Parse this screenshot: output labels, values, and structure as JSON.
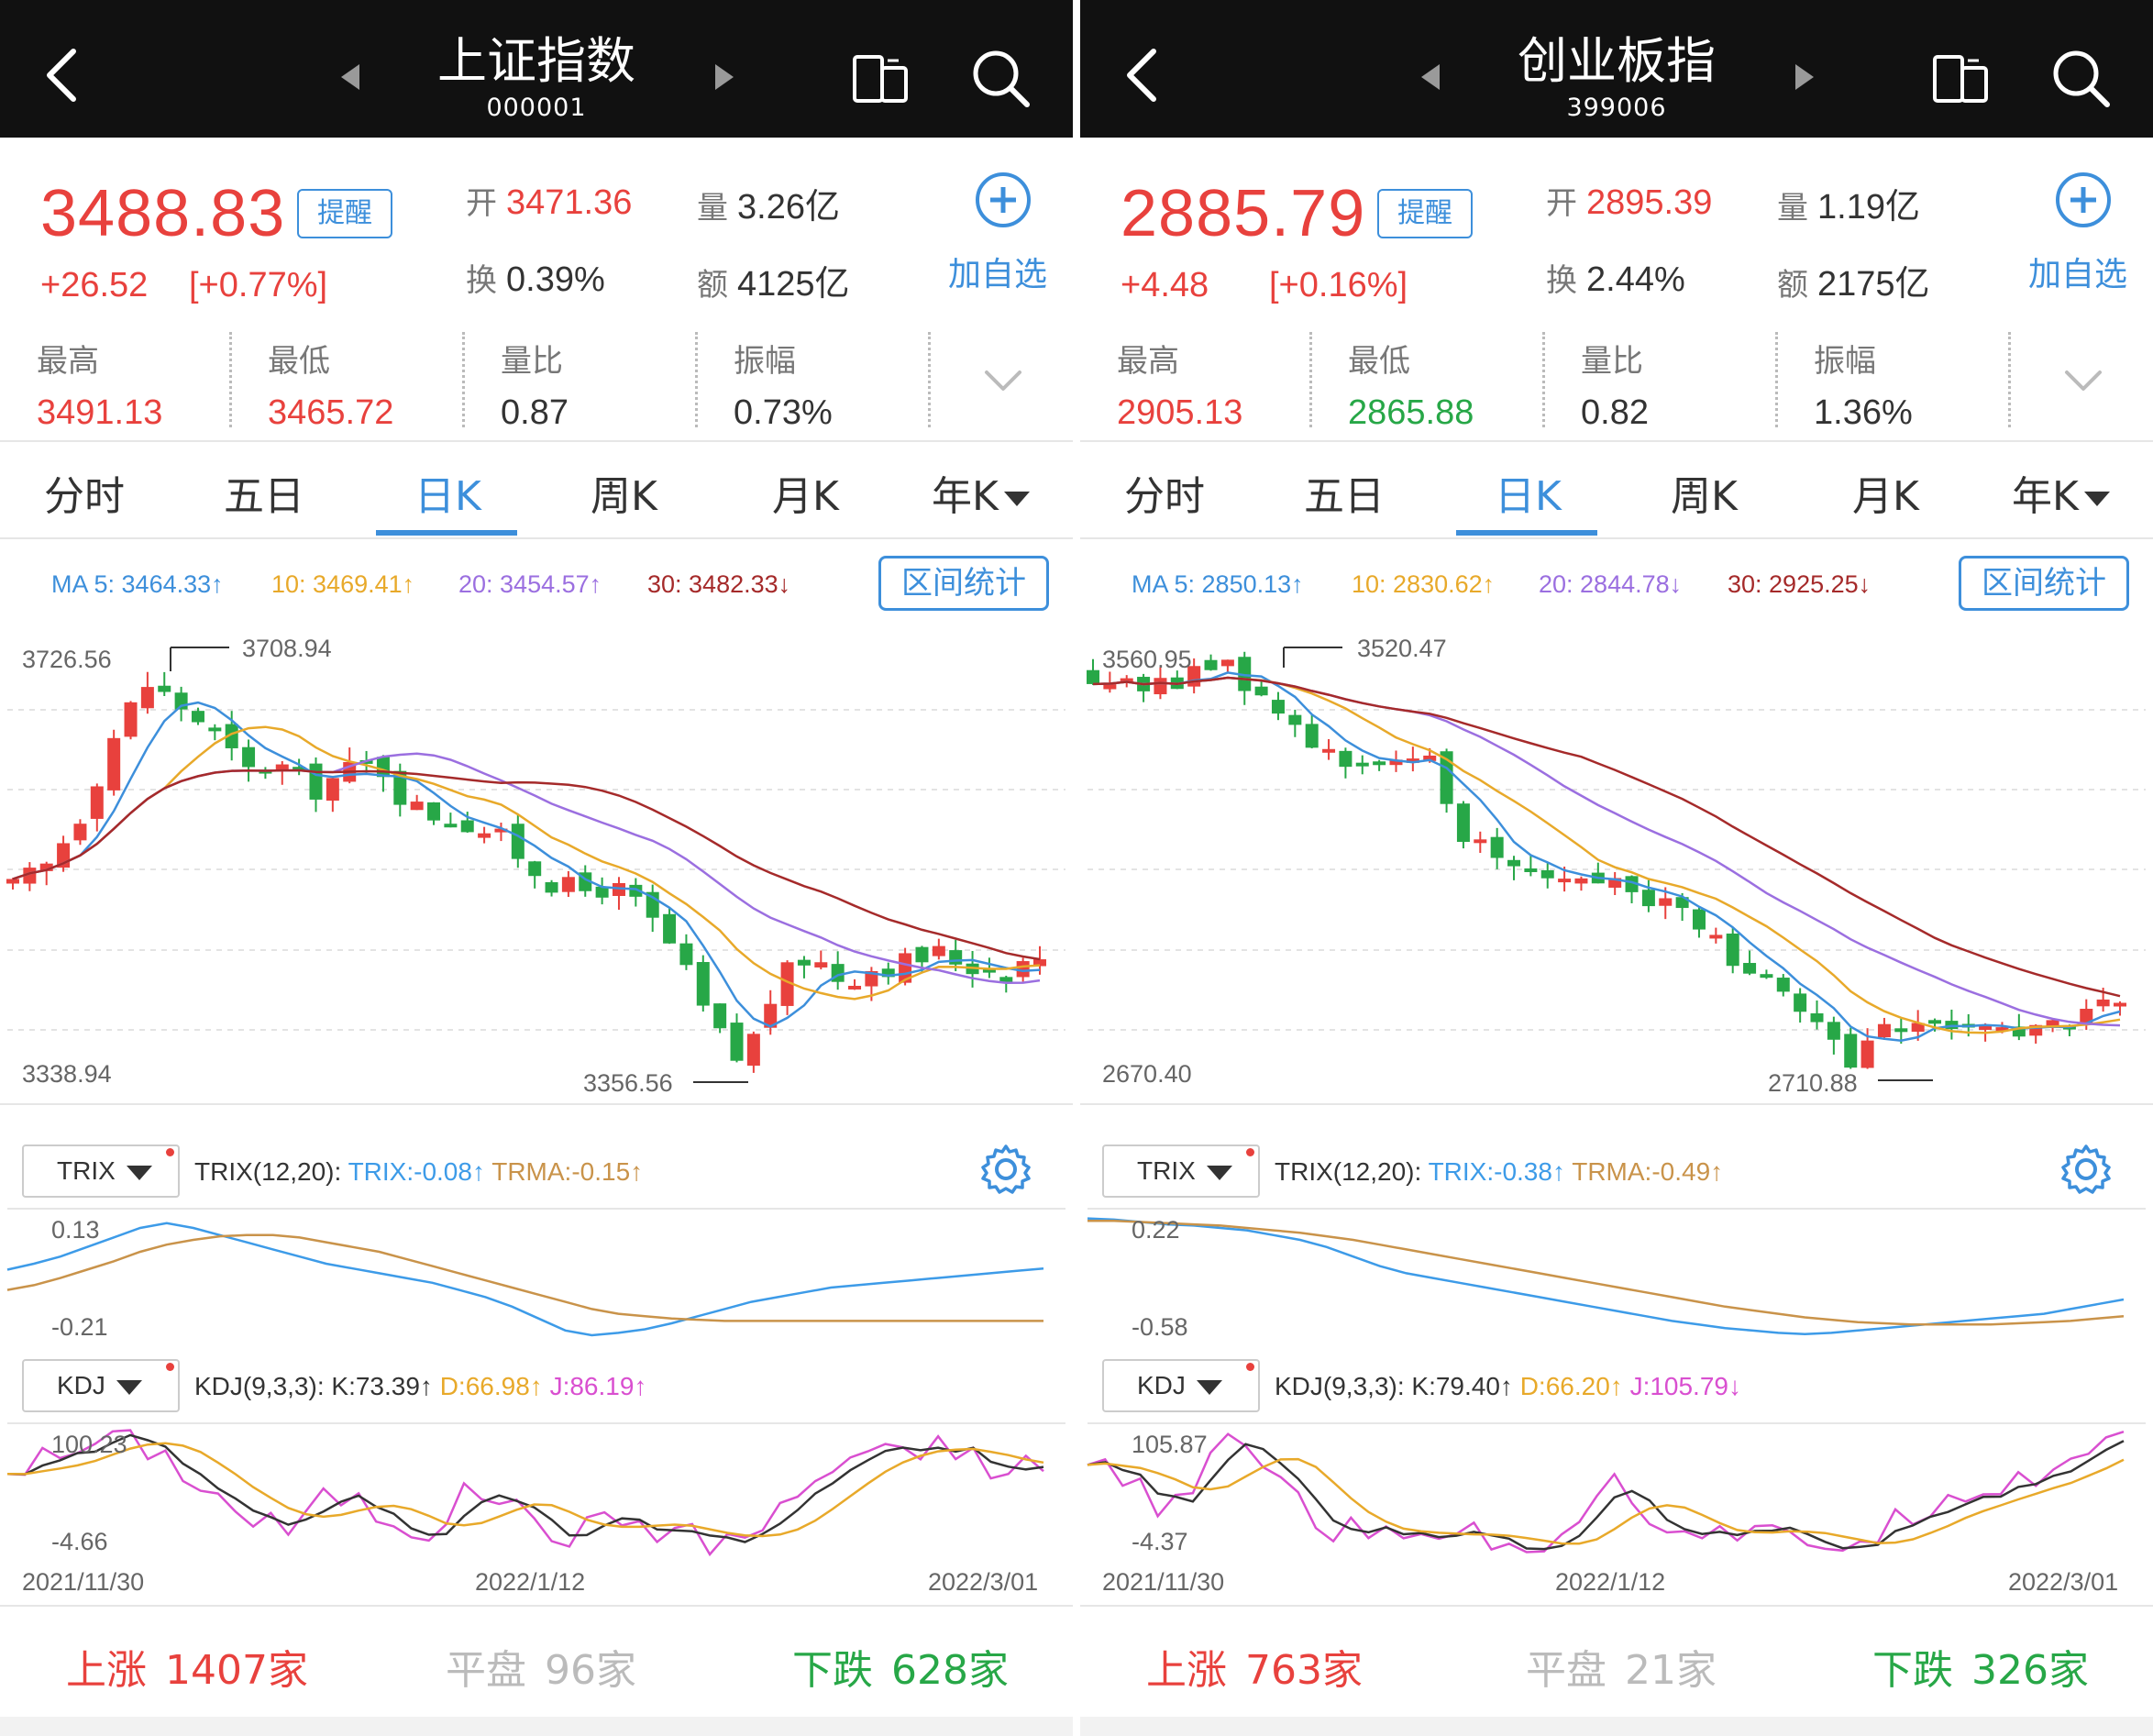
{
  "colors": {
    "up": "#e8413d",
    "down": "#27a747",
    "accent": "#3d8fdb",
    "ma5": "#3d8fdb",
    "ma10": "#e8a92a",
    "ma20": "#9b6fe0",
    "ma30": "#a52a2a",
    "trix": "#3d9be8",
    "trma": "#c9934a",
    "k": "#333333",
    "d": "#e8a92a",
    "j": "#d94fd0"
  },
  "panels": [
    {
      "header": {
        "title": "上证指数",
        "code": "000001"
      },
      "quote": {
        "price": "3488.83",
        "alert_label": "提醒",
        "change": "+26.52",
        "change_pct": "[+0.77%]",
        "open_k": "开",
        "open_v": "3471.36",
        "vol_k": "量",
        "vol_v": "3.26亿",
        "turn_k": "换",
        "turn_v": "0.39%",
        "amt_k": "额",
        "amt_v": "4125亿",
        "add_label": "加自选"
      },
      "stats": [
        {
          "label": "最高",
          "value": "3491.13"
        },
        {
          "label": "最低",
          "value": "3465.72"
        },
        {
          "label": "量比",
          "value": "0.87"
        },
        {
          "label": "振幅",
          "value": "0.73%"
        }
      ],
      "tabs": [
        "分时",
        "五日",
        "日K",
        "周K",
        "月K",
        "年K"
      ],
      "ma": {
        "ma5": "MA 5: 3464.33↑",
        "ma10": "10: 3469.41↑",
        "ma20": "20: 3454.57↑",
        "ma30": "30: 3482.33↓"
      },
      "range_btn": "区间统计",
      "axis": {
        "top": "3726.56",
        "bottom": "3338.94",
        "high_mark": "3708.94",
        "low_mark": "3356.56"
      },
      "trix": {
        "btn": "TRIX",
        "params": "TRIX(12,20):",
        "trix": "TRIX:-0.08↑",
        "trma": "TRMA:-0.15↑",
        "top": "0.13",
        "bottom": "-0.21"
      },
      "kdj": {
        "btn": "KDJ",
        "params": "KDJ(9,3,3):",
        "k": "K:73.39↑",
        "d": "D:66.98↑",
        "j": "J:86.19↑",
        "top": "100.23",
        "bottom": "-4.66"
      },
      "dates": [
        "2021/11/30",
        "2022/1/12",
        "2022/3/01"
      ],
      "footer": {
        "up_label": "上涨",
        "up_value": "1407家",
        "flat_label": "平盘",
        "flat_value": "96家",
        "down_label": "下跌",
        "down_value": "628家"
      }
    },
    {
      "header": {
        "title": "创业板指",
        "code": "399006"
      },
      "quote": {
        "price": "2885.79",
        "alert_label": "提醒",
        "change": "+4.48",
        "change_pct": "[+0.16%]",
        "open_k": "开",
        "open_v": "2895.39",
        "vol_k": "量",
        "vol_v": "1.19亿",
        "turn_k": "换",
        "turn_v": "2.44%",
        "amt_k": "额",
        "amt_v": "2175亿",
        "add_label": "加自选"
      },
      "stats": [
        {
          "label": "最高",
          "value": "2905.13"
        },
        {
          "label": "最低",
          "value": "2865.88"
        },
        {
          "label": "量比",
          "value": "0.82"
        },
        {
          "label": "振幅",
          "value": "1.36%"
        }
      ],
      "tabs": [
        "分时",
        "五日",
        "日K",
        "周K",
        "月K",
        "年K"
      ],
      "ma": {
        "ma5": "MA 5: 2850.13↑",
        "ma10": "10: 2830.62↑",
        "ma20": "20: 2844.78↓",
        "ma30": "30: 2925.25↓"
      },
      "range_btn": "区间统计",
      "axis": {
        "top": "3560.95",
        "bottom": "2670.40",
        "high_mark": "3520.47",
        "low_mark": "2710.88"
      },
      "trix": {
        "btn": "TRIX",
        "params": "TRIX(12,20):",
        "trix": "TRIX:-0.38↑",
        "trma": "TRMA:-0.49↑",
        "top": "0.22",
        "bottom": "-0.58"
      },
      "kdj": {
        "btn": "KDJ",
        "params": "KDJ(9,3,3):",
        "k": "K:79.40↑",
        "d": "D:66.20↑",
        "j": "J:105.79↓",
        "top": "105.87",
        "bottom": "-4.37"
      },
      "dates": [
        "2021/11/30",
        "2022/1/12",
        "2022/3/01"
      ],
      "footer": {
        "up_label": "上涨",
        "up_value": "763家",
        "flat_label": "平盘",
        "flat_value": "21家",
        "down_label": "下跌",
        "down_value": "326家"
      }
    }
  ]
}
